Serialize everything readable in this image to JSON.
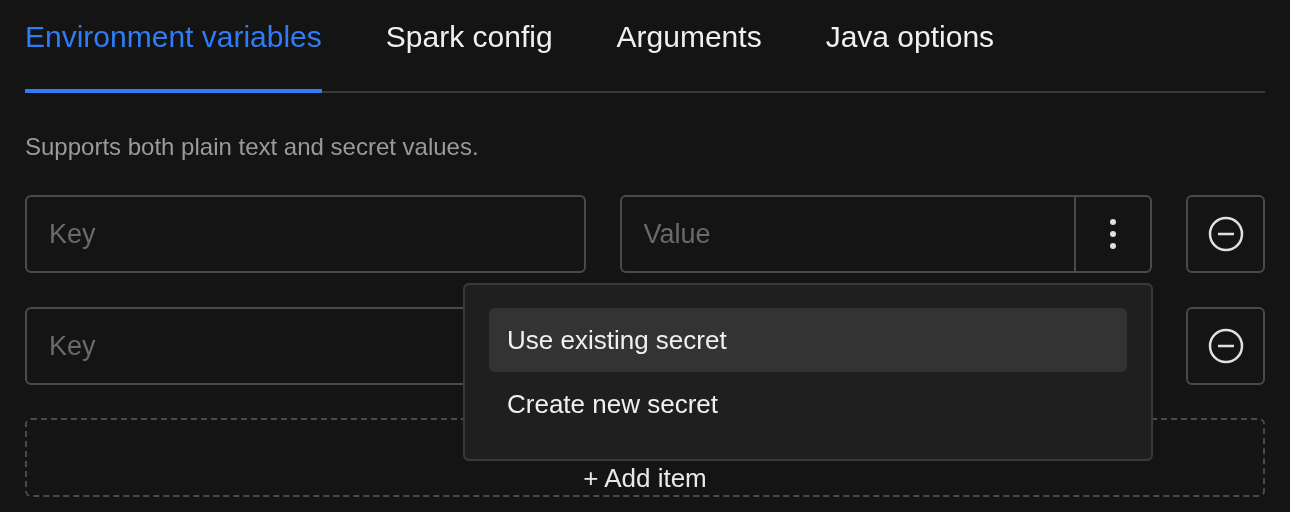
{
  "tabs": [
    {
      "label": "Environment variables",
      "selected": true
    },
    {
      "label": "Spark config",
      "selected": false
    },
    {
      "label": "Arguments",
      "selected": false
    },
    {
      "label": "Java options",
      "selected": false
    }
  ],
  "description": "Supports both plain text and secret values.",
  "rows": [
    {
      "key_placeholder": "Key",
      "value_placeholder": "Value"
    },
    {
      "key_placeholder": "Key"
    }
  ],
  "menu": {
    "items": [
      {
        "label": "Use existing secret",
        "selected": true
      },
      {
        "label": "Create new secret",
        "selected": false
      }
    ]
  },
  "add_button": {
    "label": "+ Add item"
  }
}
